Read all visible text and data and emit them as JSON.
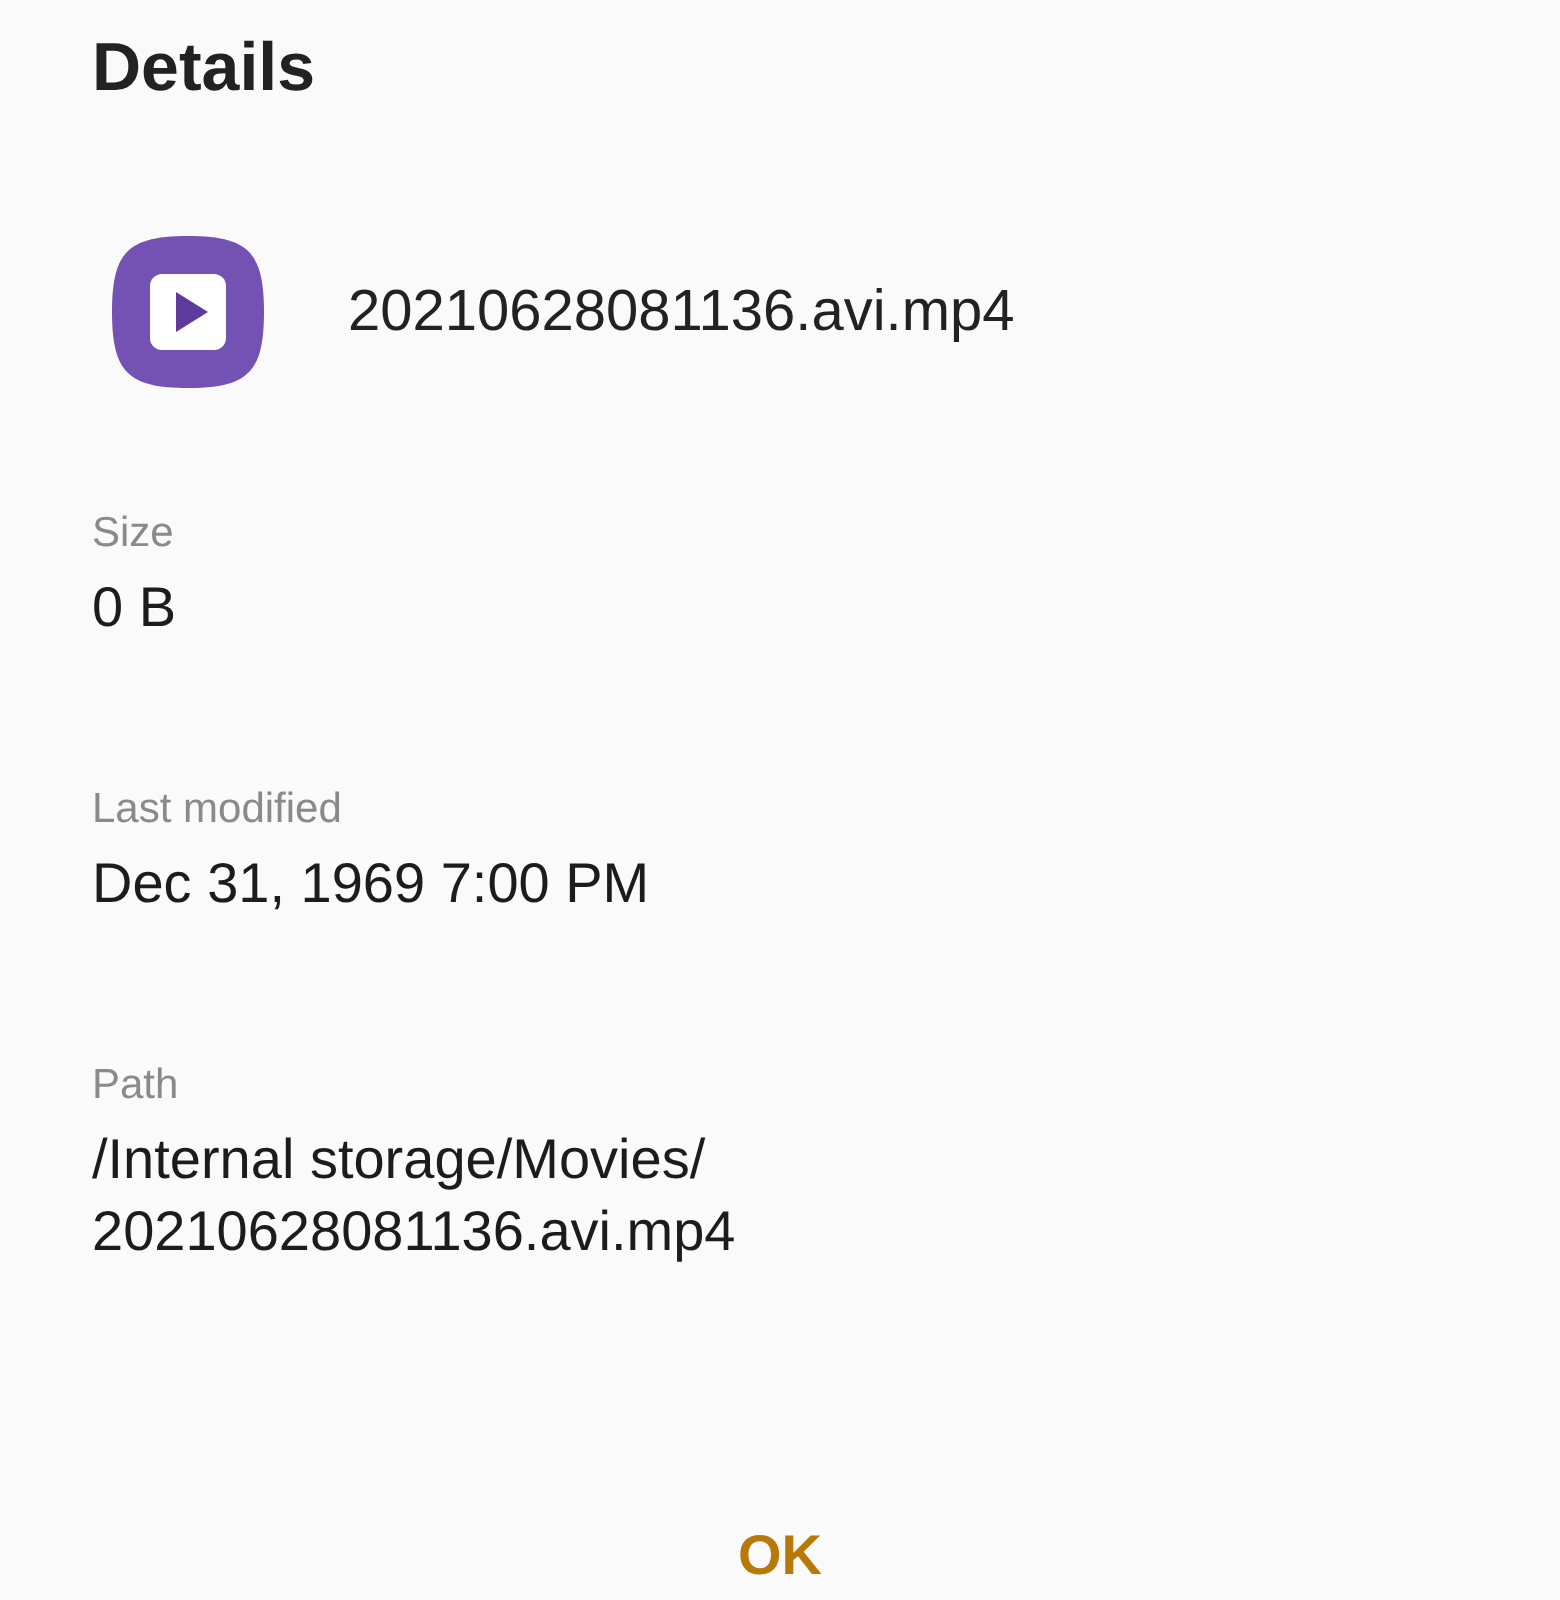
{
  "dialog": {
    "title": "Details"
  },
  "file": {
    "name": "20210628081136.avi.mp4"
  },
  "fields": [
    {
      "label": "Size",
      "value": "0 B"
    },
    {
      "label": "Last modified",
      "value": "Dec 31, 1969 7:00 PM"
    },
    {
      "label": "Path",
      "value": "/Internal storage/Movies/ 20210628081136.avi.mp4"
    }
  ],
  "buttons": [
    "OK"
  ]
}
